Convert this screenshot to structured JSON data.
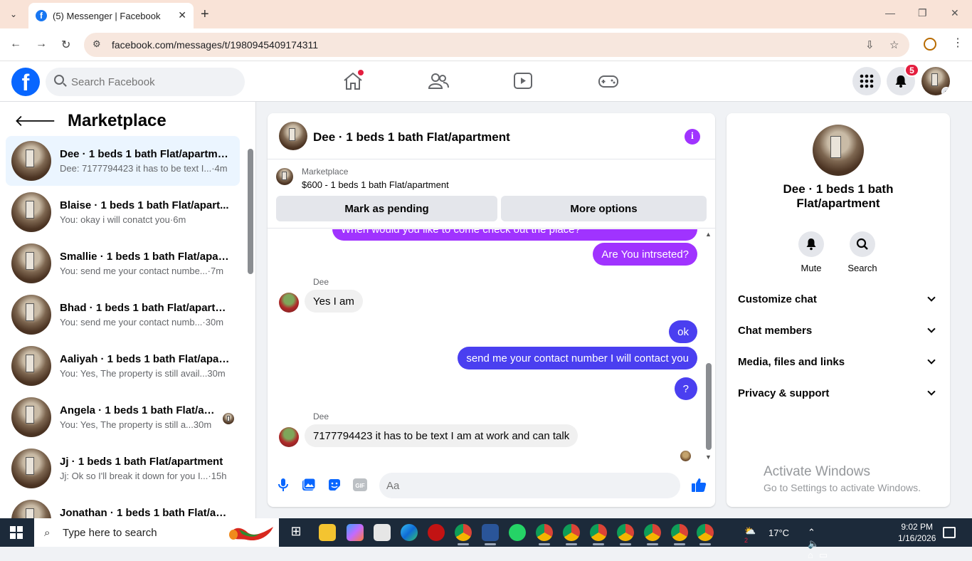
{
  "browser": {
    "tab_title": "(5) Messenger | Facebook",
    "tab_close": "✕",
    "new_tab": "+",
    "url": "facebook.com/messages/t/1980945409174311"
  },
  "fb": {
    "search_placeholder": "Search Facebook",
    "logo_letter": "f",
    "notification_count": "5"
  },
  "sidebar": {
    "title": "Marketplace",
    "conversations": [
      {
        "name": "Dee · 1 beds 1 bath Flat/apartment",
        "preview": "Dee: 7177794423 it has to be text I...",
        "time": "·4m",
        "active": true
      },
      {
        "name": "Blaise · 1 beds 1 bath Flat/apart...",
        "preview": "You: okay i will conatct you",
        "time": "·6m"
      },
      {
        "name": "Smallie · 1 beds 1 bath Flat/apart...",
        "preview": "You: send me your contact numbe...",
        "time": "·7m"
      },
      {
        "name": "Bhad · 1 beds 1 bath Flat/apartm...",
        "preview": "You: send me your contact numb...",
        "time": "·30m"
      },
      {
        "name": "Aaliyah · 1 beds 1 bath Flat/apart...",
        "preview": "You: Yes, The property is still avail...",
        "time": "30m"
      },
      {
        "name": "Angela · 1 beds 1 bath Flat/ap...",
        "preview": "You: Yes, The property is still a...",
        "time": "30m"
      },
      {
        "name": "Jj · 1 beds 1 bath Flat/apartment",
        "preview": "Jj: Ok so I'll break it down for you I...",
        "time": "·15h"
      },
      {
        "name": "Jonathan · 1 beds 1 bath Flat/ap...",
        "preview": "",
        "time": ""
      }
    ]
  },
  "chat": {
    "title": "Dee · 1 beds 1 bath Flat/apartment",
    "info_icon": "i",
    "marketplace_label": "Marketplace",
    "listing": "$600 - 1 beds 1 bath Flat/apartment",
    "mark_pending": "Mark as pending",
    "more_options": "More options",
    "messages": [
      {
        "from": "me",
        "text": "When would you like to come check out the place?"
      },
      {
        "from": "me",
        "text": "Are You intrseted?"
      },
      {
        "from": "Dee",
        "sender_label": "Dee",
        "text": "Yes I am"
      },
      {
        "from": "me",
        "text": "ok"
      },
      {
        "from": "me",
        "text": "send me your contact number I will contact you"
      },
      {
        "from": "me",
        "text": "?"
      },
      {
        "from": "Dee",
        "sender_label": "Dee",
        "text": "7177794423 it has to be text I am at work and can talk"
      }
    ],
    "composer_placeholder": "Aa",
    "gif_label": "GIF"
  },
  "details": {
    "name": "Dee · 1 beds 1 bath Flat/apartment",
    "actions": [
      {
        "label": "Mute"
      },
      {
        "label": "Search"
      }
    ],
    "sections": [
      "Customize chat",
      "Chat members",
      "Media, files and links",
      "Privacy & support"
    ]
  },
  "watermark": {
    "line1": "Activate Windows",
    "line2": "Go to Settings to activate Windows."
  },
  "taskbar": {
    "search_placeholder": "Type here to search",
    "weather_badge": "2",
    "temperature": "17°C",
    "time": "9:02 PM",
    "date": "1/16/2026"
  },
  "colors": {
    "accent_purple": "#a033ff",
    "accent_blue": "#4a3ff0",
    "fb_blue": "#0866ff",
    "active_row": "#ebf5ff"
  }
}
